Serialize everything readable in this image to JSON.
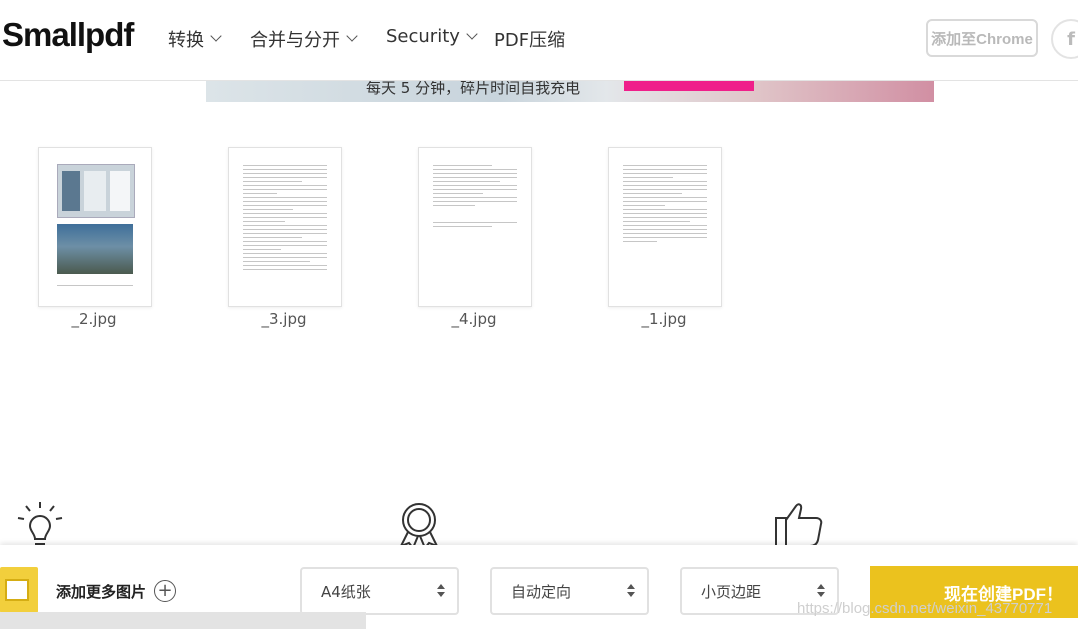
{
  "header": {
    "logo": "Smallpdf",
    "nav": [
      {
        "label": "转换"
      },
      {
        "label": "合并与分开"
      },
      {
        "label": "Security"
      },
      {
        "label": "PDF压缩"
      }
    ],
    "chrome_button": "添加至Chrome",
    "facebook_icon": "f"
  },
  "banner": {
    "text": "每天 5 分钟，碎片时间自我充电"
  },
  "thumbnails": [
    {
      "name": "_2.jpg"
    },
    {
      "name": "_3.jpg"
    },
    {
      "name": "_4.jpg"
    },
    {
      "name": "_1.jpg"
    }
  ],
  "features": {
    "icons": [
      "lightbulb-icon",
      "award-ribbon-icon",
      "thumbs-up-icon"
    ]
  },
  "bottombar": {
    "add_more_label": "添加更多图片",
    "page_size": "A4纸张",
    "orientation": "自动定向",
    "margin": "小页边距",
    "create_button": "现在创建PDF！",
    "watermark": "https://blog.csdn.net/weixin_43770771"
  },
  "colors": {
    "accent_yellow": "#ebc21e",
    "banner_pink": "#ef1f8a"
  }
}
